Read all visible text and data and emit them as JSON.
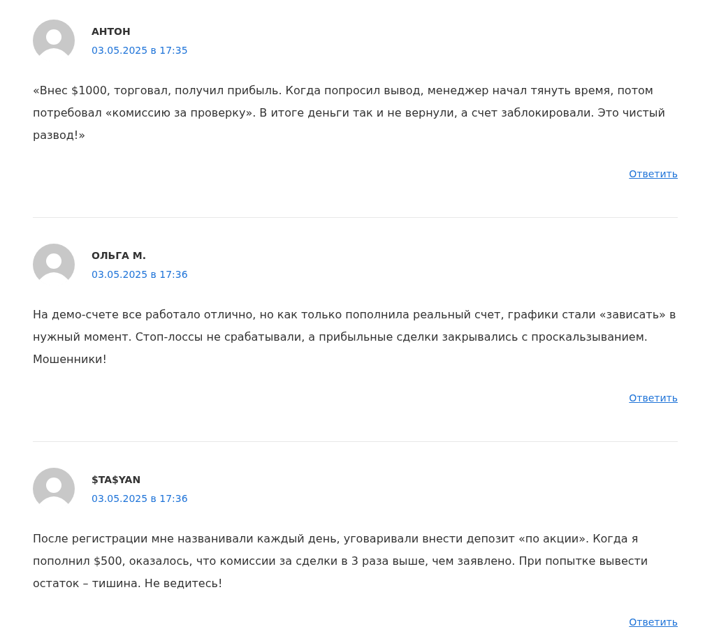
{
  "comments": [
    {
      "author": "АНТОН",
      "date": "03.05.2025 в 17:35",
      "text": "«Внес $1000, торговал, получил прибыль. Когда попросил вывод, менеджер начал тянуть время, потом потребовал «комиссию за проверку». В итоге деньги так и не вернули, а счет заблокировали. Это чистый развод!»",
      "reply": "Ответить"
    },
    {
      "author": "ОЛЬГА М.",
      "date": "03.05.2025 в 17:36",
      "text": "На демо-счете все работало отлично, но как только пополнила реальный счет, графики стали «зависать» в нужный момент. Стоп-лоссы не срабатывали, а прибыльные сделки закрывались с проскальзыванием. Мошенники!",
      "reply": "Ответить"
    },
    {
      "author": "$TA$YAN",
      "date": "03.05.2025 в 17:36",
      "text": "После регистрации мне названивали каждый день, уговаривали внести депозит «по акции». Когда я пополнил $500, оказалось, что комиссии за сделки в 3 раза выше, чем заявлено. При попытке вывести остаток – тишина. Не ведитесь!",
      "reply": "Ответить"
    }
  ]
}
